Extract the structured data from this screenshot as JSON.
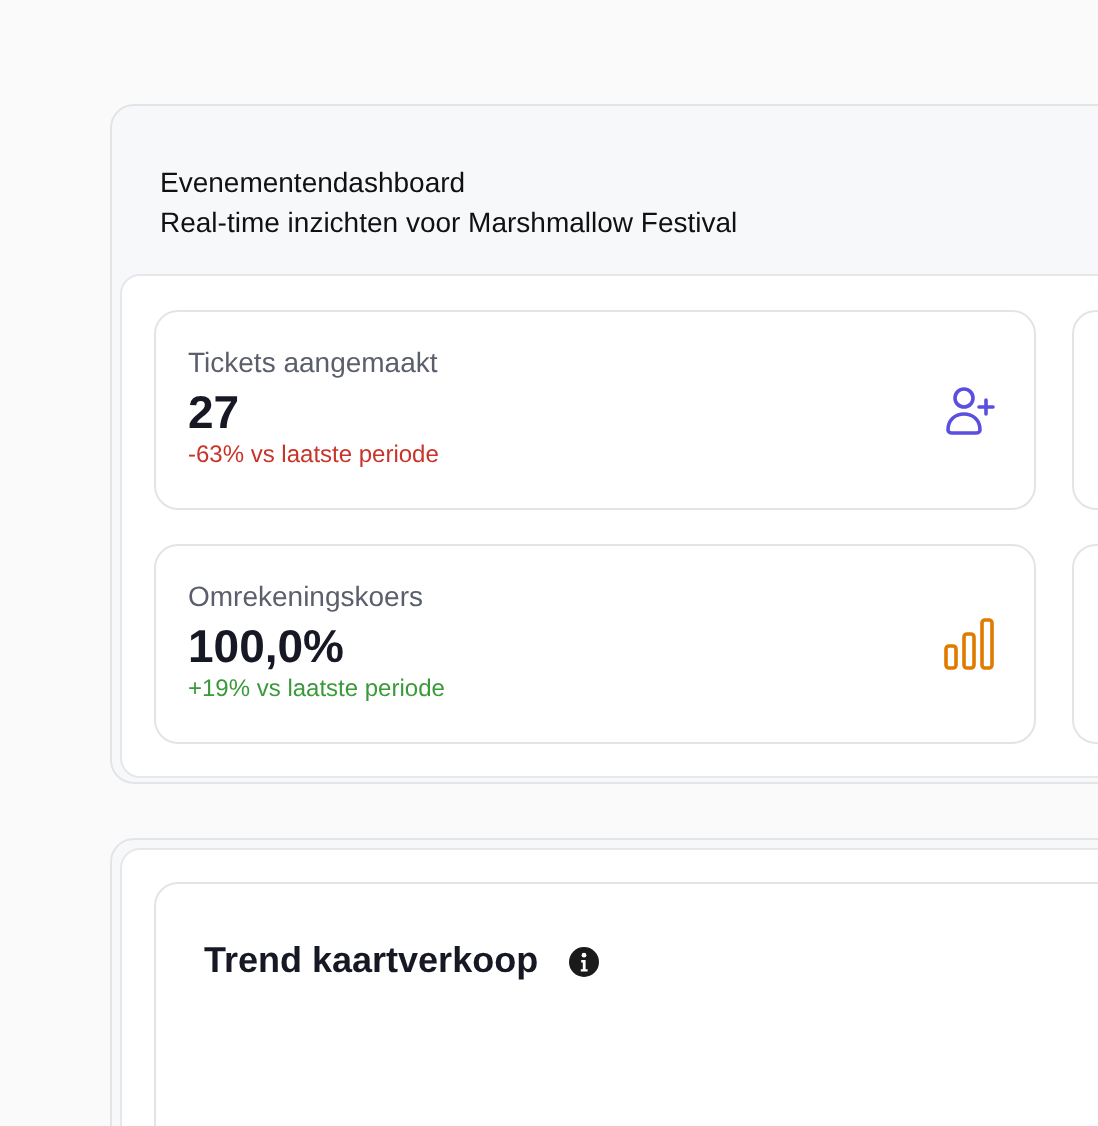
{
  "dashboard": {
    "title": "Evenementendashboard",
    "subtitle": "Real-time inzichten voor Marshmallow Festival"
  },
  "stats": [
    {
      "label": "Tickets aangemaakt",
      "value": "27",
      "change": "-63% vs laatste periode",
      "color": "#c9342a",
      "kind": "user"
    },
    {
      "label": "Omrekeningskoers",
      "value": "100,0%",
      "change": "+19% vs laatste periode",
      "color": "#3a9a3a",
      "kind": "chart"
    }
  ],
  "trend_panel": {
    "title": "Trend kaartverkoop"
  }
}
